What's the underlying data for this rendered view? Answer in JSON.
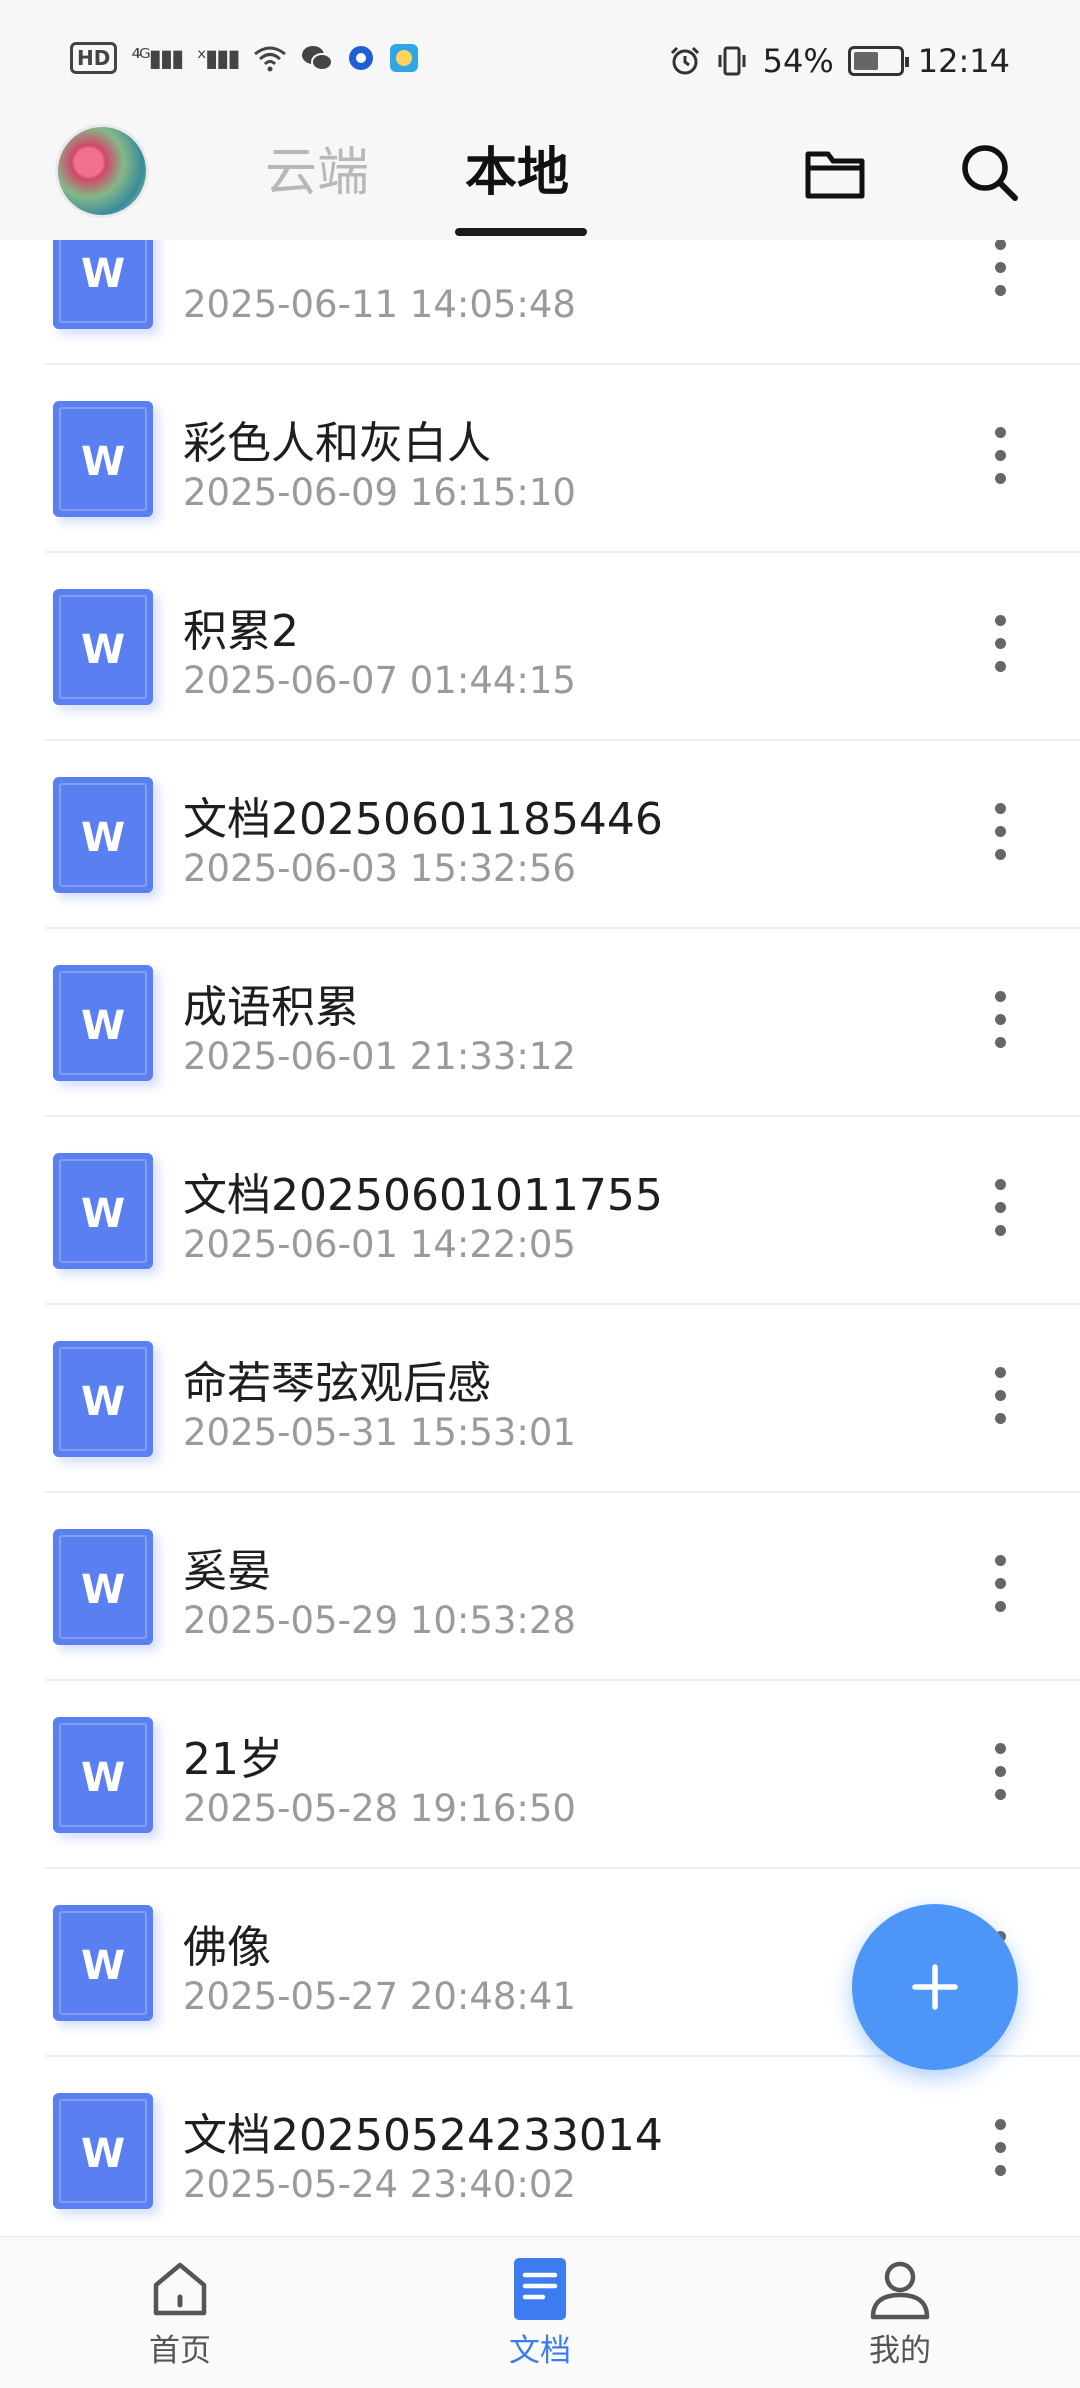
{
  "status_bar": {
    "left": [
      "HD",
      "4G",
      "signal",
      "signal-off",
      "wifi",
      "wechat",
      "app-icon",
      "app-icon-2"
    ],
    "battery_percent": "54%",
    "battery_level": 0.54,
    "time": "12:14"
  },
  "header": {
    "tabs": [
      {
        "label": "云端",
        "active": false
      },
      {
        "label": "本地",
        "active": true
      }
    ]
  },
  "files": [
    {
      "title": "",
      "date": "2025-06-11 14:05:48"
    },
    {
      "title": "彩色人和灰白人",
      "date": "2025-06-09 16:15:10"
    },
    {
      "title": "积累2",
      "date": "2025-06-07 01:44:15"
    },
    {
      "title": "文档20250601185446",
      "date": "2025-06-03 15:32:56"
    },
    {
      "title": "成语积累",
      "date": "2025-06-01 21:33:12"
    },
    {
      "title": "文档20250601011755",
      "date": "2025-06-01 14:22:05"
    },
    {
      "title": "命若琴弦观后感",
      "date": "2025-05-31 15:53:01"
    },
    {
      "title": "奚晏",
      "date": "2025-05-29 10:53:28"
    },
    {
      "title": "21岁",
      "date": "2025-05-28 19:16:50"
    },
    {
      "title": "佛像",
      "date": "2025-05-27 20:48:41"
    },
    {
      "title": "文档20250524233014",
      "date": "2025-05-24 23:40:02"
    },
    {
      "title": "",
      "date": ""
    }
  ],
  "doc_icon_letter": "W",
  "bottom_nav": [
    {
      "label": "首页",
      "icon": "home-icon",
      "active": false
    },
    {
      "label": "文档",
      "icon": "document-icon",
      "active": true
    },
    {
      "label": "我的",
      "icon": "profile-icon",
      "active": false
    }
  ],
  "colors": {
    "accent": "#4d96f7",
    "doc_icon": "#5a7ff0",
    "active_nav": "#3d7cf0"
  }
}
